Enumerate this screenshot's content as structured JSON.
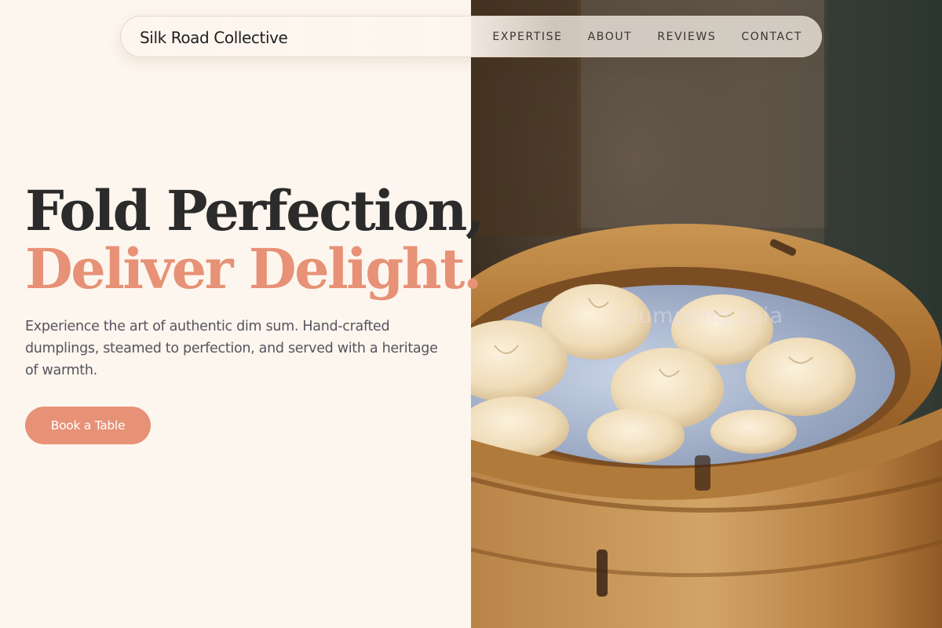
{
  "brand": {
    "name": "Silk Road Collective"
  },
  "nav": {
    "items": [
      {
        "label": "EXPERTISE"
      },
      {
        "label": "ABOUT"
      },
      {
        "label": "REVIEWS"
      },
      {
        "label": "CONTACT"
      }
    ]
  },
  "hero": {
    "title_line_1": "Fold Perfection,",
    "title_line_2": "Deliver Delight.",
    "description": "Experience the art of authentic dim sum. Hand-crafted dumplings, steamed to perfection, and served with a heritage of warmth.",
    "cta_label": "Book a Table"
  },
  "photo": {
    "watermark": "dumpling.asia"
  },
  "colors": {
    "background": "#fdf6ee",
    "accent": "#e79176",
    "heading": "#2b2b2b",
    "body_text": "#55555f"
  }
}
